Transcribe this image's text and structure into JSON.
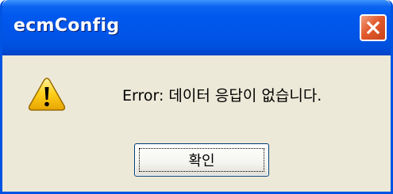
{
  "window": {
    "title": "ecmConfig"
  },
  "dialog": {
    "message": "Error: 데이터 응답이 없습니다.",
    "ok_label": "확인"
  },
  "icons": {
    "dialog_icon": "warning-icon",
    "close_icon": "close-icon"
  },
  "colors": {
    "titlebar": "#0055e8",
    "close_button": "#e25a2c",
    "dialog_background": "#ece9d8",
    "warning_yellow": "#ffd21e"
  }
}
